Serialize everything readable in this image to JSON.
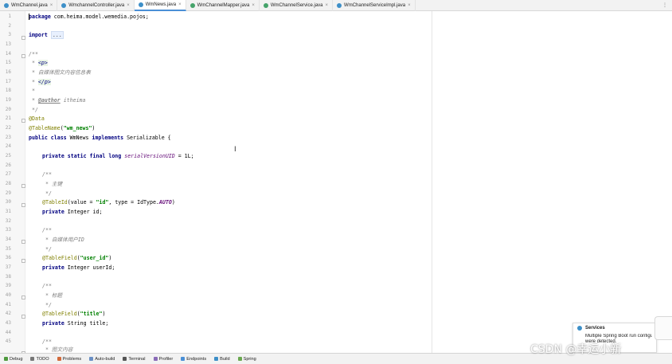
{
  "tabs": [
    {
      "label": "WmChannel.java",
      "active": false
    },
    {
      "label": "WmchannelController.java",
      "active": false
    },
    {
      "label": "WmNews.java",
      "active": true
    },
    {
      "label": "WmChannelMapper.java",
      "active": false
    },
    {
      "label": "WmChannelService.java",
      "active": false
    },
    {
      "label": "WmChannelServiceImpl.java",
      "active": false
    }
  ],
  "tabs_close_glyph": "×",
  "tabs_more_glyph": "⋮",
  "line_numbers": [
    "1",
    "2",
    "3",
    "13",
    "14",
    "15",
    "16",
    "17",
    "18",
    "19",
    "20",
    "21",
    "22",
    "23",
    "24",
    "25",
    "26",
    "27",
    "28",
    "29",
    "30",
    "31",
    "32",
    "33",
    "34",
    "35",
    "36",
    "37",
    "38",
    "39",
    "40",
    "41",
    "42",
    "43",
    "44",
    "45"
  ],
  "code": {
    "package_kw": "package",
    "package_name": " com.heima.model.wemedia.pojos;",
    "import_kw": "import",
    "import_fold": "...",
    "doc_open": "/**",
    "doc_p_prefix": " * ",
    "doc_p_open": "<p>",
    "doc_desc": " * 自媒体图文内容信息表",
    "doc_p_close": "</p>",
    "doc_star": " *",
    "doc_author_tag": "@author",
    "doc_author_name": " itheima",
    "doc_close": " */",
    "ann_data": "@Data",
    "ann_tablename": "@TableName",
    "tablename_open": "(",
    "tablename_value": "\"wm_news\"",
    "tablename_close": ")",
    "class_kw": "public class",
    "class_name": " WmNews ",
    "implements_kw": "implements",
    "class_rest": " Serializable {",
    "serial_kw": "private static final long",
    "serial_field": "serialVersionUID",
    "serial_rest": " = 1L;",
    "c1_open": "/**",
    "c1_text": " * 主键",
    "c1_close": " */",
    "ann_tableid": "@TableId",
    "tableid_value_open": "(value = ",
    "tableid_value": "\"id\"",
    "tableid_type": ", type = IdType.",
    "tableid_auto": "AUTO",
    "tableid_close": ")",
    "id_kw": "private",
    "id_rest": " Integer id;",
    "c2_open": "/**",
    "c2_text": " * 自媒体用户ID",
    "c2_close": " */",
    "ann_tablefield_1": "@TableField",
    "tf1_open": "(",
    "tf1_value": "\"user_id\"",
    "tf1_close": ")",
    "uid_kw": "private",
    "uid_rest": " Integer userId;",
    "c3_open": "/**",
    "c3_text": " * 标题",
    "c3_close": " */",
    "ann_tablefield_2": "@TableField",
    "tf2_open": "(",
    "tf2_value": "\"title\"",
    "tf2_close": ")",
    "title_kw": "private",
    "title_rest": " String title;",
    "c4_open": "/**",
    "c4_text": " * 图文内容"
  },
  "bottom_bar": [
    {
      "label": "Debug",
      "color": "#4e9a3e"
    },
    {
      "label": "TODO",
      "color": "#777777"
    },
    {
      "label": "Problems",
      "color": "#d26a3a"
    },
    {
      "label": "Auto-build",
      "color": "#6a8fc4"
    },
    {
      "label": "Terminal",
      "color": "#555555"
    },
    {
      "label": "Profiler",
      "color": "#8a6bb8"
    },
    {
      "label": "Endpoints",
      "color": "#4a8fd6"
    },
    {
      "label": "Build",
      "color": "#3d8fc8"
    },
    {
      "label": "Spring",
      "color": "#6aa84f"
    }
  ],
  "notification": {
    "title": "Services",
    "line1": "Multiple Spring Boot run configu",
    "line2": "were detected."
  },
  "watermark": "CSDN @幸运小新",
  "colors": {
    "keyword": "#000080",
    "string": "#008000",
    "annotation": "#808000",
    "comment": "#808080",
    "static_field": "#660e7a",
    "active_tab_underline": "#4a8fd6"
  }
}
